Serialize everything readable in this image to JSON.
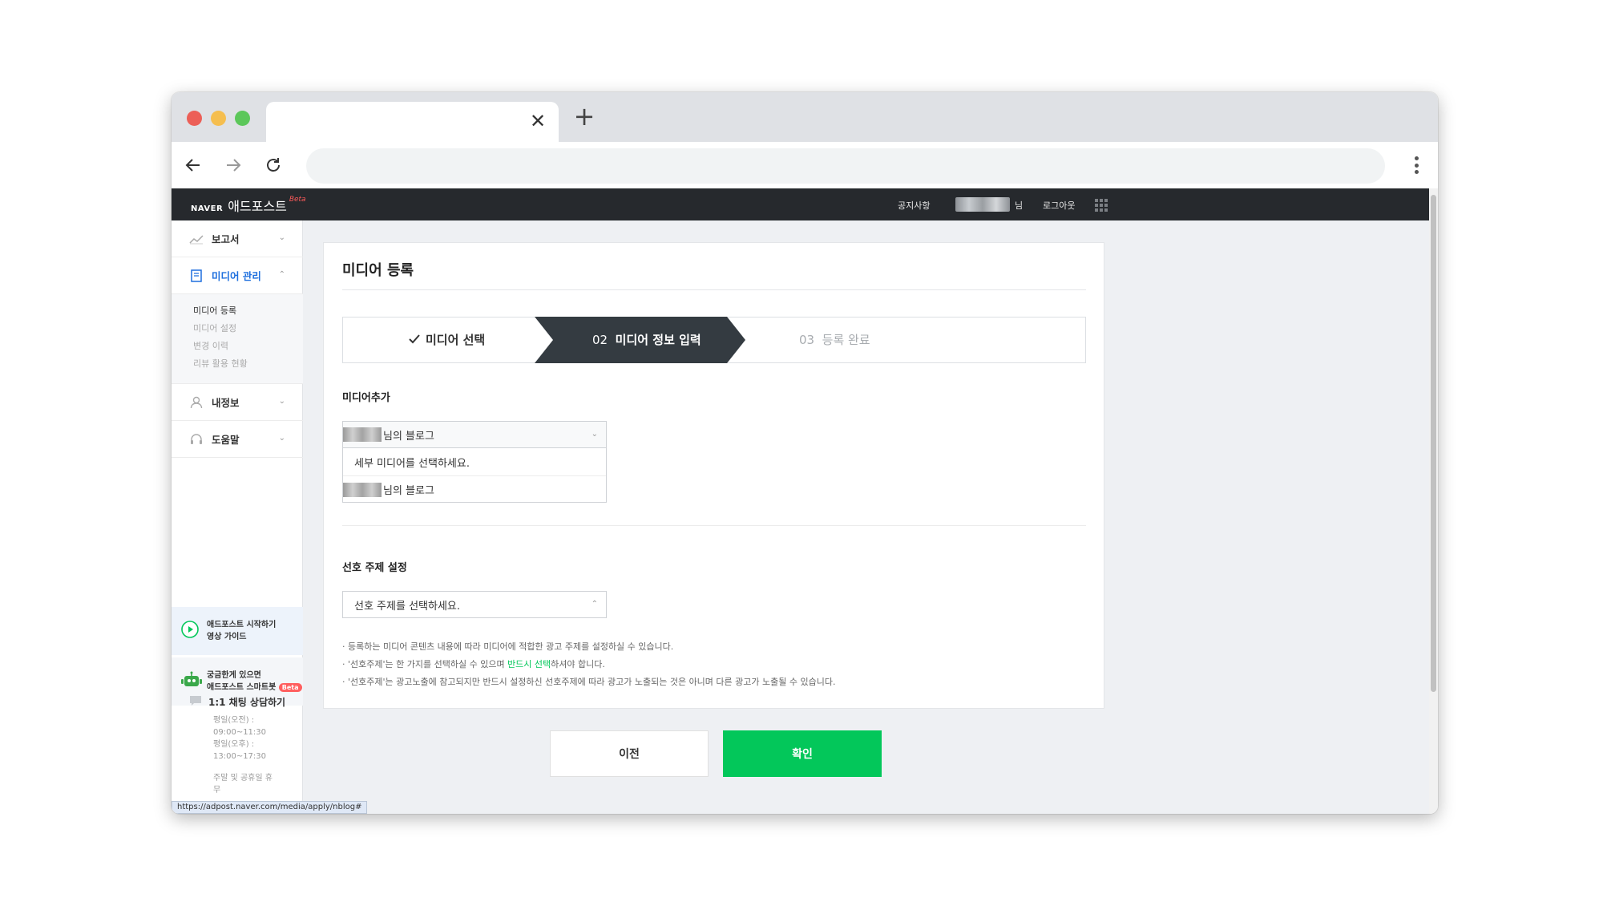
{
  "browser": {
    "tab_close": "✕",
    "new_tab": "+"
  },
  "header": {
    "logo_naver": "NAVER",
    "logo_service": "애드포스트",
    "logo_beta": "Beta",
    "notice": "공지사항",
    "user_suffix": "님",
    "logout": "로그아웃"
  },
  "sidebar": {
    "items": [
      {
        "label": "보고서",
        "icon": "chart-icon"
      },
      {
        "label": "미디어 관리",
        "icon": "media-icon"
      },
      {
        "label": "내정보",
        "icon": "user-icon"
      },
      {
        "label": "도움말",
        "icon": "headset-icon"
      }
    ],
    "submenu": [
      "미디어 등록",
      "미디어 설정",
      "변경 이력",
      "리뷰 활용 현황"
    ],
    "promo_video_line1": "애드포스트 시작하기",
    "promo_video_line2": "영상 가이드",
    "promo_bot_line1": "궁금한게 있으면",
    "promo_bot_line2": "애드포스트 스마트봇",
    "promo_bot_badge": "Beta",
    "chat_title": "1:1 채팅 상담하기",
    "chat_lines": [
      "평일(오전) :",
      "09:00~11:30",
      "평일(오후) :",
      "13:00~17:30",
      "",
      "주말 및 공휴일 휴",
      "무"
    ]
  },
  "status_url": "https://adpost.naver.com/media/apply/nblog#",
  "main": {
    "title": "미디어 등록",
    "steps": {
      "step1": "미디어 선택",
      "step2_num": "02",
      "step2": "미디어 정보 입력",
      "step3_num": "03",
      "step3": "등록 완료"
    },
    "media_add_label": "미디어추가",
    "media_select_value": "님의 블로그",
    "dropdown_options": [
      "세부 미디어를 선택하세요.",
      "님의 블로그"
    ],
    "preferred_label": "선호 주제 설정",
    "preferred_placeholder": "선호 주제를 선택하세요.",
    "notes": [
      "· 등록하는 미디어 콘텐츠 내용에 따라 미디어에 적합한 광고 주제를 설정하실 수 있습니다.",
      "· '선호주제'는 한 가지를 선택하실 수 있으며 ",
      "반드시 선택",
      "하셔야 합니다.",
      "· '선호주제'는 광고노출에 참고되지만 반드시 설정하신 선호주제에 따라 광고가 노출되는 것은 아니며 다른 광고가 노출될 수 있습니다."
    ],
    "prev_button": "이전",
    "confirm_button": "확인"
  },
  "colors": {
    "accent_green": "#03c75a",
    "active_blue": "#1e6fde",
    "header_dark": "#26292d",
    "step_active": "#343b41"
  }
}
